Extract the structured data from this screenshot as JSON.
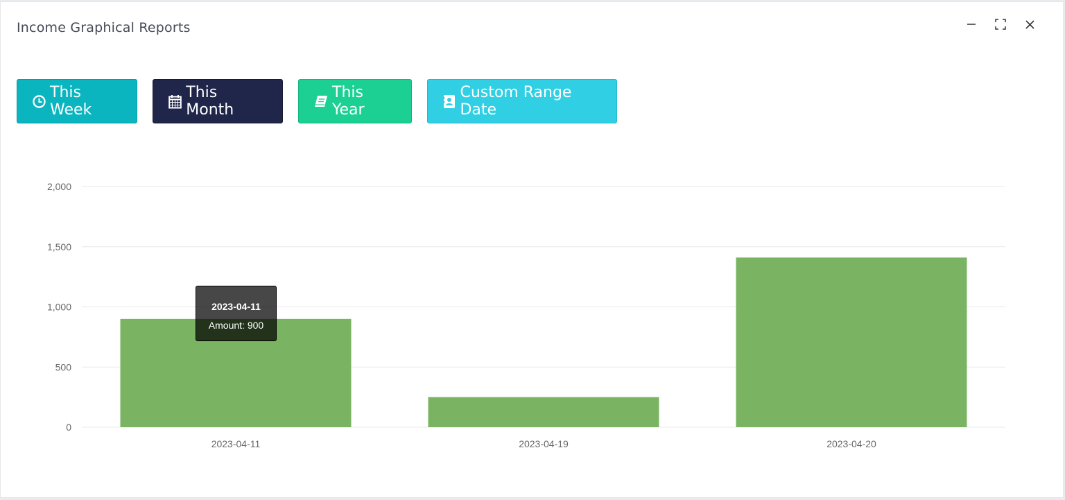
{
  "window": {
    "title": "Income Graphical Reports",
    "controls": [
      {
        "icon": "minimize-icon"
      },
      {
        "icon": "fullscreen-icon"
      },
      {
        "icon": "close-icon"
      }
    ]
  },
  "filters": {
    "this_week": {
      "label": "This Week",
      "icon": "clock-icon",
      "color": "#0ab5bf"
    },
    "this_month": {
      "label": "This Month",
      "icon": "calendar-icon",
      "color": "#20264a"
    },
    "this_year": {
      "label": "This Year",
      "icon": "book-icon",
      "color": "#1cd094"
    },
    "custom_range": {
      "label": "Custom Range Date",
      "icon": "contact-book-icon",
      "color": "#31cfe4"
    }
  },
  "chart_data": {
    "type": "bar",
    "categories": [
      "2023-04-11",
      "2023-04-19",
      "2023-04-20"
    ],
    "values": [
      900,
      250,
      1410
    ],
    "ylim": [
      0,
      2000
    ],
    "yticks": [
      0,
      500,
      1000,
      1500,
      2000
    ],
    "ytick_labels": [
      "0",
      "500",
      "1,000",
      "1,500",
      "2,000"
    ],
    "bar_color": "#7ab463",
    "grid": true
  },
  "tooltip": {
    "title": "2023-04-11",
    "body": "Amount: 900"
  }
}
